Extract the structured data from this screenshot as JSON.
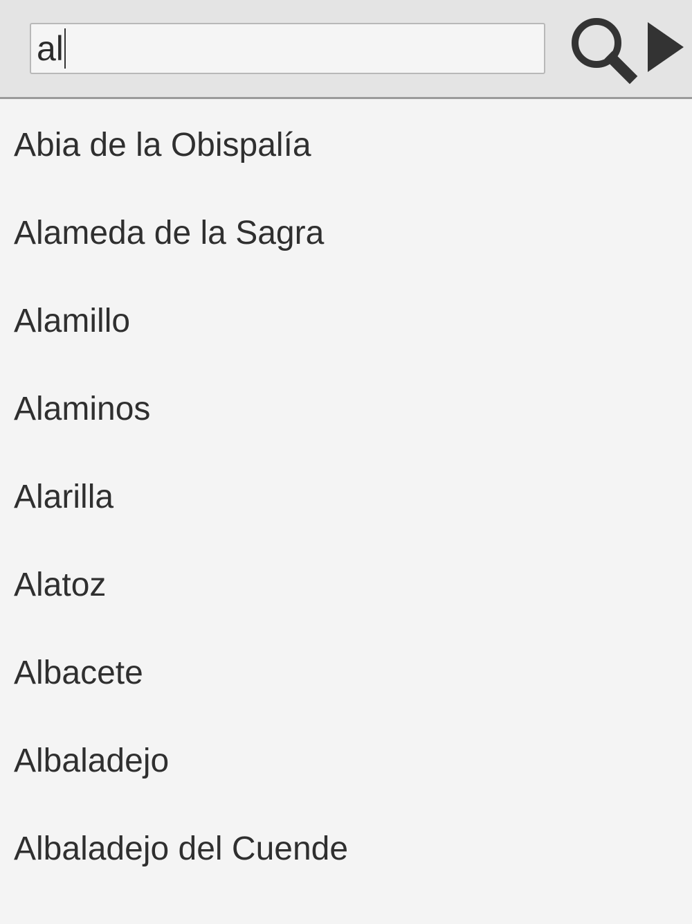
{
  "search": {
    "value": "al"
  },
  "toolbar": {
    "search_icon": "search-icon",
    "go_icon": "play-arrow-icon"
  },
  "results": [
    "Abia de la Obispalía",
    "Alameda de la Sagra",
    "Alamillo",
    "Alaminos",
    "Alarilla",
    "Alatoz",
    "Albacete",
    "Albaladejo",
    "Albaladejo del Cuende"
  ],
  "colors": {
    "topbar": "#e4e4e4",
    "background": "#f4f4f4",
    "text": "#2f2f2f",
    "icon": "#333333"
  }
}
